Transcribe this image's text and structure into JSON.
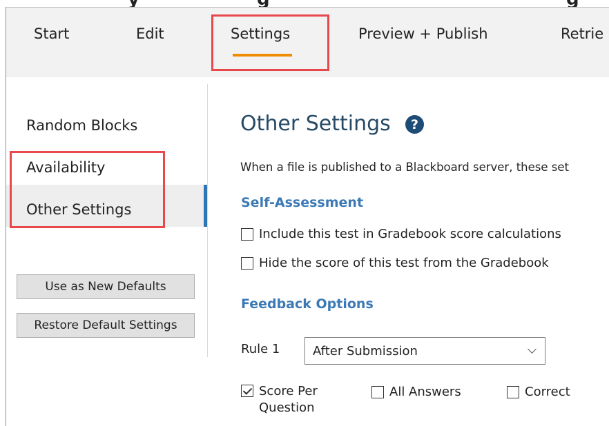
{
  "tabs": [
    {
      "label": "Start"
    },
    {
      "label": "Edit"
    },
    {
      "label": "Settings"
    },
    {
      "label": "Preview + Publish"
    },
    {
      "label": "Retrie"
    }
  ],
  "sidebar": {
    "items": [
      {
        "label": "Random Blocks"
      },
      {
        "label": "Availability"
      },
      {
        "label": "Other Settings"
      }
    ],
    "buttons": {
      "defaults": "Use as New Defaults",
      "restore": "Restore Default Settings"
    }
  },
  "main": {
    "title": "Other Settings",
    "help_icon": "?",
    "description": "When a file is published to a Blackboard server, these set",
    "self_assessment": {
      "title": "Self-Assessment",
      "include_label": "Include this test in Gradebook score calculations",
      "include_checked": false,
      "hide_label": "Hide the score of this test from the  Gradebook",
      "hide_checked": false
    },
    "feedback": {
      "title": "Feedback Options",
      "rule_label": "Rule 1",
      "rule_value": "After Submission",
      "score_line1": "Score Per",
      "score_line2": "Question",
      "score_checked": true,
      "all_answers": "All Answers",
      "all_answers_checked": false,
      "correct": "Correct",
      "correct_checked": false
    }
  },
  "colors": {
    "accent_underline": "#f08c00",
    "highlight_box": "#e8474c",
    "section_title": "#3b79b5",
    "heading": "#264a66",
    "active_bar": "#2e75b6"
  }
}
